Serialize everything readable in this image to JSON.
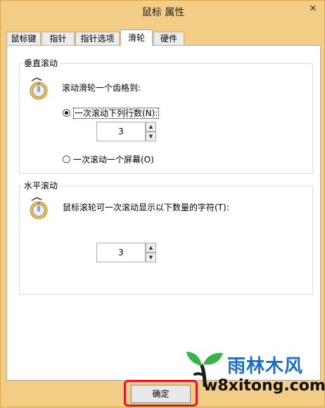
{
  "window": {
    "title": "鼠标 属性",
    "close_glyph": "✕"
  },
  "tabs": [
    {
      "label": "鼠标键",
      "active": false
    },
    {
      "label": "指针",
      "active": false
    },
    {
      "label": "指针选项",
      "active": false
    },
    {
      "label": "滑轮",
      "active": true
    },
    {
      "label": "硬件",
      "active": false
    }
  ],
  "vertical": {
    "title": "垂直滚动",
    "intro": "滚动滑轮一个齿格到:",
    "option_lines_label": "一次滚动下列行数(N):",
    "option_lines_checked": true,
    "lines_value": "3",
    "option_screen_label": "一次滚动一个屏幕(O)",
    "option_screen_checked": false
  },
  "horizontal": {
    "title": "水平滚动",
    "intro": "鼠标滚轮可一次滚动显示以下数量的字符(T):",
    "chars_value": "3"
  },
  "buttons": {
    "ok_label": "确定"
  },
  "watermark": {
    "cn": "雨林木风",
    "en": "w8xitong.com"
  },
  "colors": {
    "highlight": "#e0182f",
    "watermark_blue": "#1a6fc4",
    "title_bar": "#f3cd85"
  }
}
